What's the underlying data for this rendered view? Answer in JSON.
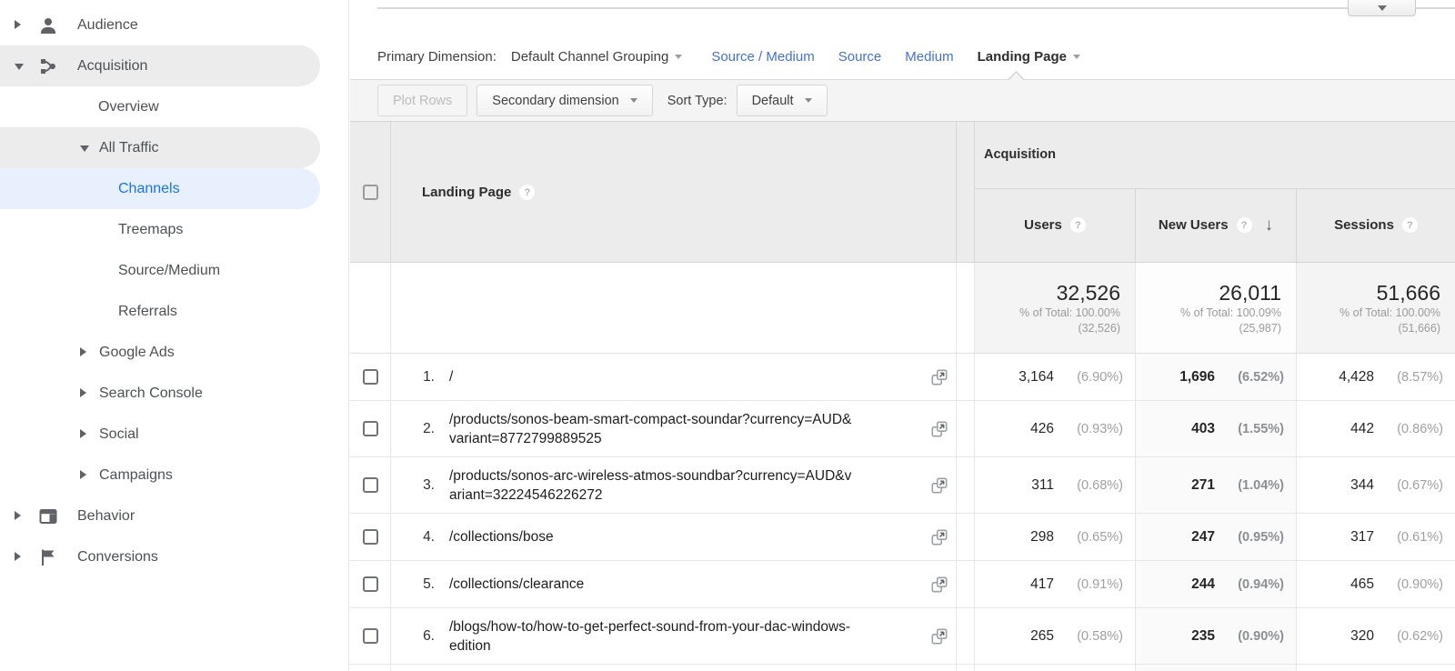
{
  "sidebar": {
    "items": [
      {
        "label": "Audience"
      },
      {
        "label": "Acquisition"
      },
      {
        "label": "Overview"
      },
      {
        "label": "All Traffic"
      },
      {
        "label": "Channels"
      },
      {
        "label": "Treemaps"
      },
      {
        "label": "Source/Medium"
      },
      {
        "label": "Referrals"
      },
      {
        "label": "Google Ads"
      },
      {
        "label": "Search Console"
      },
      {
        "label": "Social"
      },
      {
        "label": "Campaigns"
      },
      {
        "label": "Behavior"
      },
      {
        "label": "Conversions"
      }
    ]
  },
  "primary_dimension": {
    "label": "Primary Dimension:",
    "selected": "Default Channel Grouping",
    "links": [
      "Source / Medium",
      "Source",
      "Medium"
    ],
    "active": "Landing Page"
  },
  "toolbar": {
    "plot_rows": "Plot Rows",
    "secondary_dimension": "Secondary dimension",
    "sort_type_label": "Sort Type:",
    "sort_type_value": "Default"
  },
  "table": {
    "dimension_header": "Landing Page",
    "group_header": "Acquisition",
    "columns": [
      "Users",
      "New Users",
      "Sessions"
    ],
    "totals": {
      "users": {
        "value": "32,526",
        "pct_line": "% of Total: 100.00%",
        "abs_line": "(32,526)"
      },
      "new_users": {
        "value": "26,011",
        "pct_line": "% of Total: 100.09%",
        "abs_line": "(25,987)"
      },
      "sessions": {
        "value": "51,666",
        "pct_line": "% of Total: 100.00%",
        "abs_line": "(51,666)"
      }
    },
    "rows": [
      {
        "num": "1.",
        "path": "/",
        "users": "3,164",
        "users_pct": "(6.90%)",
        "new_users": "1,696",
        "new_users_pct": "(6.52%)",
        "sessions": "4,428",
        "sessions_pct": "(8.57%)"
      },
      {
        "num": "2.",
        "path": "/products/sonos-beam-smart-compact-soundar?currency=AUD&\nvariant=8772799889525",
        "users": "426",
        "users_pct": "(0.93%)",
        "new_users": "403",
        "new_users_pct": "(1.55%)",
        "sessions": "442",
        "sessions_pct": "(0.86%)"
      },
      {
        "num": "3.",
        "path": "/products/sonos-arc-wireless-atmos-soundbar?currency=AUD&v\nariant=32224546226272",
        "users": "311",
        "users_pct": "(0.68%)",
        "new_users": "271",
        "new_users_pct": "(1.04%)",
        "sessions": "344",
        "sessions_pct": "(0.67%)"
      },
      {
        "num": "4.",
        "path": "/collections/bose",
        "users": "298",
        "users_pct": "(0.65%)",
        "new_users": "247",
        "new_users_pct": "(0.95%)",
        "sessions": "317",
        "sessions_pct": "(0.61%)"
      },
      {
        "num": "5.",
        "path": "/collections/clearance",
        "users": "417",
        "users_pct": "(0.91%)",
        "new_users": "244",
        "new_users_pct": "(0.94%)",
        "sessions": "465",
        "sessions_pct": "(0.90%)"
      },
      {
        "num": "6.",
        "path": "/blogs/how-to/how-to-get-perfect-sound-from-your-dac-windows-\nedition",
        "users": "265",
        "users_pct": "(0.58%)",
        "new_users": "235",
        "new_users_pct": "(0.90%)",
        "sessions": "320",
        "sessions_pct": "(0.62%)"
      }
    ]
  },
  "icons": {
    "help": "?",
    "sort_desc": "↓"
  },
  "colors": {
    "active_blue": "#1a73e8",
    "active_bg": "#e8f0fe",
    "link_blue": "#4272d3"
  }
}
